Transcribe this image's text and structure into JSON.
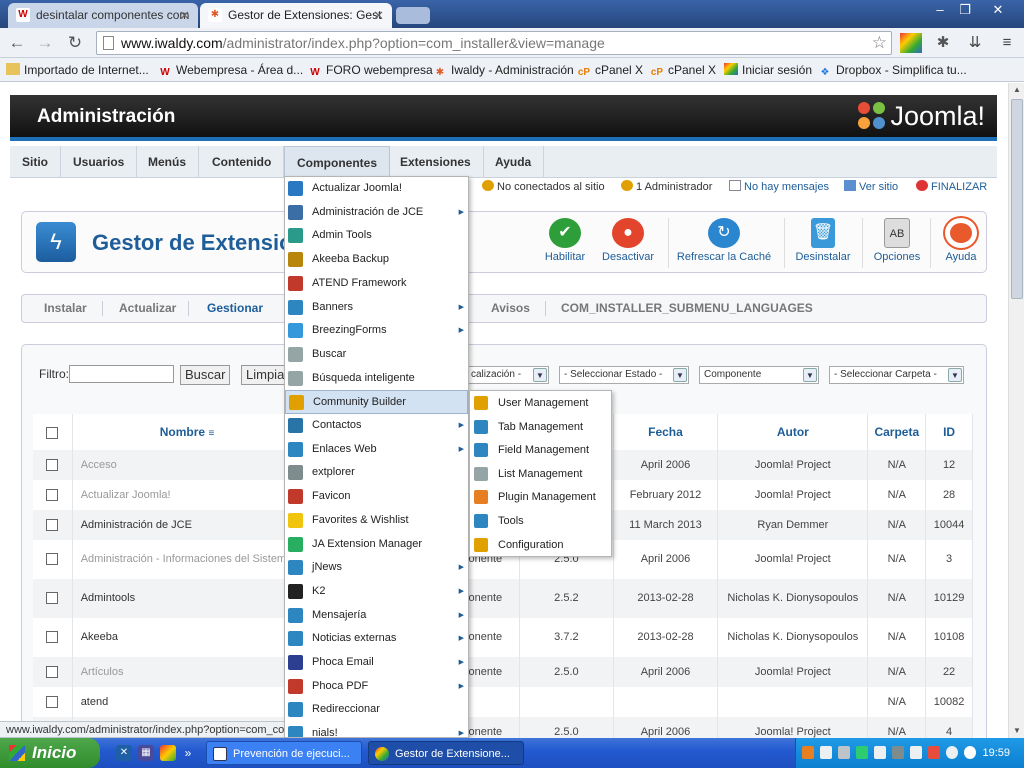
{
  "browser": {
    "tabs": [
      {
        "title": "desintalar componentes com",
        "icon": "w-icon"
      },
      {
        "title": "Gestor de Extensiones: Gest",
        "icon": "joomla-icon"
      }
    ],
    "url": {
      "host": "www.iwaldy.com",
      "path": "/administrator/index.php?option=com_installer&view=manage"
    },
    "bookmarks": [
      "Importado de Internet...",
      "Webempresa - Área d...",
      "FORO webempresa",
      "Iwaldy - Administración",
      "cPanel X",
      "cPanel X",
      "Iniciar sesión",
      "Dropbox - Simplifica tu..."
    ],
    "status_url": "www.iwaldy.com/administrator/index.php?option=com_comprofiler"
  },
  "admin": {
    "title": "Administración",
    "logo_text": "Joomla!",
    "menu": [
      "Sitio",
      "Usuarios",
      "Menús",
      "Contenido",
      "Componentes",
      "Extensiones",
      "Ayuda"
    ],
    "status": {
      "offline": "No conectados al sitio",
      "admins": "1 Administrador",
      "messages": "No hay mensajes",
      "view_site": "Ver sitio",
      "logout": "FINALIZAR"
    },
    "page_heading": "Gestor de Extensio",
    "toolbar": [
      "Habilitar",
      "Desactivar",
      "Refrescar la Caché",
      "Desinstalar",
      "Opciones",
      "Ayuda"
    ],
    "submenu": [
      "Instalar",
      "Actualizar",
      "Gestionar",
      "Avisos",
      "COM_INSTALLER_SUBMENU_LANGUAGES"
    ],
    "filter": {
      "label": "Filtro:",
      "search_button": "Buscar",
      "clear_button": "Limpia",
      "selects": [
        "calización -",
        "- Seleccionar Estado -",
        "Componente",
        "- Seleccionar Carpeta -"
      ]
    },
    "table": {
      "headers": [
        "Nombre",
        "",
        "",
        "n",
        "Fecha",
        "Autor",
        "Carpeta",
        "ID"
      ],
      "rows": [
        {
          "name": "Acceso",
          "type": "",
          "version": "",
          "date": "April 2006",
          "author": "Joomla! Project",
          "folder": "N/A",
          "id": "12",
          "dim": true
        },
        {
          "name": "Actualizar Joomla!",
          "type": "",
          "version": "",
          "date": "February 2012",
          "author": "Joomla! Project",
          "folder": "N/A",
          "id": "28",
          "dim": true
        },
        {
          "name": "Administración de JCE",
          "type": "",
          "version": "",
          "date": "11 March 2013",
          "author": "Ryan Demmer",
          "folder": "N/A",
          "id": "10044",
          "dim": false
        },
        {
          "name": "Administración - Informaciones del Sistema",
          "type": "Componente",
          "version": "2.5.0",
          "date": "April 2006",
          "author": "Joomla! Project",
          "folder": "N/A",
          "id": "3",
          "dim": true
        },
        {
          "name": "Admintools",
          "type": "Componente",
          "version": "2.5.2",
          "date": "2013-02-28",
          "author": "Nicholas K. Dionysopoulos",
          "folder": "N/A",
          "id": "10129",
          "dim": false
        },
        {
          "name": "Akeeba",
          "type": "Componente",
          "version": "3.7.2",
          "date": "2013-02-28",
          "author": "Nicholas K. Dionysopoulos",
          "folder": "N/A",
          "id": "10108",
          "dim": false
        },
        {
          "name": "Artículos",
          "type": "Componente",
          "version": "2.5.0",
          "date": "April 2006",
          "author": "Joomla! Project",
          "folder": "N/A",
          "id": "22",
          "dim": true
        },
        {
          "name": "atend",
          "type": "",
          "version": "",
          "date": "",
          "author": "",
          "folder": "N/A",
          "id": "10082",
          "dim": false
        },
        {
          "name": "",
          "type": "Componente",
          "version": "2.5.0",
          "date": "April 2006",
          "author": "Joomla! Project",
          "folder": "N/A",
          "id": "4",
          "dim": true
        }
      ]
    },
    "components_menu": [
      {
        "label": "Actualizar Joomla!",
        "icon": "update-icon",
        "color": "#2a78c2",
        "sub": false
      },
      {
        "label": "Administración de JCE",
        "icon": "jce-icon",
        "color": "#3a6ea5",
        "sub": true
      },
      {
        "label": "Admin Tools",
        "icon": "shield-icon",
        "color": "#2a9a8a",
        "sub": false
      },
      {
        "label": "Akeeba Backup",
        "icon": "akeeba-icon",
        "color": "#b8860b",
        "sub": false
      },
      {
        "label": "ATEND Framework",
        "icon": "gears-icon",
        "color": "#c0392b",
        "sub": false
      },
      {
        "label": "Banners",
        "icon": "banners-icon",
        "color": "#2e86c1",
        "sub": true
      },
      {
        "label": "BreezingForms",
        "icon": "forms-icon",
        "color": "#3498db",
        "sub": true
      },
      {
        "label": "Buscar",
        "icon": "search-icon",
        "color": "#95a5a6",
        "sub": false
      },
      {
        "label": "Búsqueda inteligente",
        "icon": "smart-search-icon",
        "color": "#95a5a6",
        "sub": false
      },
      {
        "label": "Community Builder",
        "icon": "community-icon",
        "color": "#e0a000",
        "sub": false
      },
      {
        "label": "Contactos",
        "icon": "contacts-icon",
        "color": "#2874a6",
        "sub": true
      },
      {
        "label": "Enlaces Web",
        "icon": "weblinks-icon",
        "color": "#2e86c1",
        "sub": true
      },
      {
        "label": "extplorer",
        "icon": "close-x-icon",
        "color": "#7f8c8d",
        "sub": false
      },
      {
        "label": "Favicon",
        "icon": "favicon-icon",
        "color": "#c0392b",
        "sub": false
      },
      {
        "label": "Favorites & Wishlist",
        "icon": "star-icon",
        "color": "#f1c40f",
        "sub": false
      },
      {
        "label": "JA Extension Manager",
        "icon": "ja-icon",
        "color": "#27ae60",
        "sub": false
      },
      {
        "label": "jNews",
        "icon": "jnews-icon",
        "color": "#2e86c1",
        "sub": true
      },
      {
        "label": "K2",
        "icon": "k2-icon",
        "color": "#222222",
        "sub": true
      },
      {
        "label": "Mensajería",
        "icon": "messages-icon",
        "color": "#2e86c1",
        "sub": true
      },
      {
        "label": "Noticias externas",
        "icon": "rss-icon",
        "color": "#2e86c1",
        "sub": true
      },
      {
        "label": "Phoca Email",
        "icon": "phoca-email-icon",
        "color": "#2c3e90",
        "sub": true
      },
      {
        "label": "Phoca PDF",
        "icon": "pdf-icon",
        "color": "#c0392b",
        "sub": true
      },
      {
        "label": "Redireccionar",
        "icon": "redirect-icon",
        "color": "#2e86c1",
        "sub": false
      },
      {
        "label": "nials!",
        "icon": "tutorials-icon",
        "color": "#2e86c1",
        "sub": true
      }
    ],
    "community_builder_submenu": [
      {
        "label": "User Management",
        "icon": "users-icon",
        "color": "#e0a000"
      },
      {
        "label": "Tab Management",
        "icon": "tabs-icon",
        "color": "#2e86c1"
      },
      {
        "label": "Field Management",
        "icon": "fields-icon",
        "color": "#2e86c1"
      },
      {
        "label": "List Management",
        "icon": "list-search-icon",
        "color": "#95a5a6"
      },
      {
        "label": "Plugin Management",
        "icon": "plugin-icon",
        "color": "#e67e22"
      },
      {
        "label": "Tools",
        "icon": "tools-gear-icon",
        "color": "#2e86c1"
      },
      {
        "label": "Configuration",
        "icon": "config-icon",
        "color": "#e0a000"
      }
    ]
  },
  "taskbar": {
    "start": "Inicio",
    "tasks": [
      "Prevención de ejecuci...",
      "Gestor de Extensione..."
    ],
    "clock": "19:59"
  }
}
